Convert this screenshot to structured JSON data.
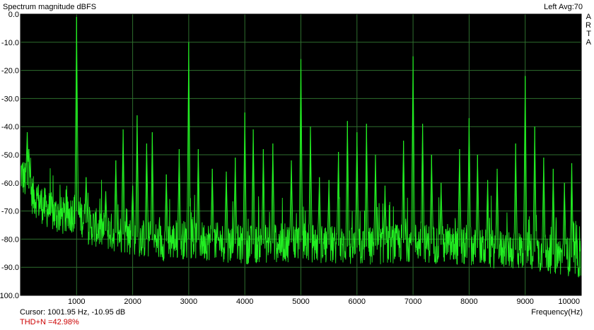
{
  "window": {
    "title": "Spectrum magnitude dBFS",
    "status": "Left  Avg:70",
    "brand": [
      "A",
      "R",
      "T",
      "A"
    ]
  },
  "footer": {
    "cursor": "Cursor: 1001.95 Hz, -10.95 dB",
    "thd": "THD+N =42.98%",
    "xlabel": "Frequency(Hz)"
  },
  "colors": {
    "plot_bg": "#000000",
    "grid": "#2e6e2e",
    "trace": "#22ee22",
    "thd_text": "#cc0000"
  },
  "chart_data": {
    "type": "line",
    "title": "Spectrum magnitude dBFS",
    "xlabel": "Frequency(Hz)",
    "ylabel": "",
    "xlim": [
      0,
      10000
    ],
    "ylim": [
      -100,
      0
    ],
    "x_ticks": [
      "1000",
      "2000",
      "3000",
      "4000",
      "5000",
      "6000",
      "7000",
      "8000",
      "9000",
      "10000"
    ],
    "y_ticks": [
      "0.0",
      "-10.0",
      "-20.0",
      "-30.0",
      "-40.0",
      "-50.0",
      "-60.0",
      "-70.0",
      "-80.0",
      "-90.0",
      "-100.0"
    ],
    "grid": true,
    "series": [
      {
        "values_noise_floor": [
          [
            100,
            -60
          ],
          [
            200,
            -64
          ],
          [
            400,
            -68
          ],
          [
            600,
            -71
          ],
          [
            800,
            -72
          ],
          [
            1000,
            -70
          ],
          [
            1200,
            -75
          ],
          [
            1500,
            -77
          ],
          [
            2000,
            -79
          ],
          [
            2500,
            -81
          ],
          [
            3000,
            -80
          ],
          [
            4000,
            -82
          ],
          [
            5000,
            -81
          ],
          [
            6000,
            -83
          ],
          [
            7000,
            -81
          ],
          [
            8000,
            -83
          ],
          [
            9000,
            -84
          ],
          [
            10000,
            -87
          ]
        ],
        "peaks": [
          [
            120,
            -42
          ],
          [
            150,
            -48
          ],
          [
            1000,
            -1
          ],
          [
            1170,
            -58
          ],
          [
            1520,
            -63
          ],
          [
            1700,
            -52
          ],
          [
            1830,
            -41
          ],
          [
            2000,
            -61
          ],
          [
            2080,
            -36
          ],
          [
            2250,
            -46
          ],
          [
            2350,
            -42
          ],
          [
            2600,
            -57
          ],
          [
            2830,
            -48
          ],
          [
            3000,
            -10
          ],
          [
            3170,
            -48
          ],
          [
            3420,
            -55
          ],
          [
            3670,
            -56
          ],
          [
            3830,
            -51
          ],
          [
            4000,
            -35
          ],
          [
            4150,
            -41
          ],
          [
            4330,
            -48
          ],
          [
            4500,
            -46
          ],
          [
            4830,
            -52
          ],
          [
            5000,
            -16
          ],
          [
            5170,
            -40
          ],
          [
            5330,
            -58
          ],
          [
            5500,
            -59
          ],
          [
            5670,
            -49
          ],
          [
            5830,
            -38
          ],
          [
            6000,
            -42
          ],
          [
            6170,
            -39
          ],
          [
            6330,
            -50
          ],
          [
            6500,
            -61
          ],
          [
            6830,
            -45
          ],
          [
            7000,
            -15
          ],
          [
            7170,
            -39
          ],
          [
            7330,
            -50
          ],
          [
            7500,
            -60
          ],
          [
            7830,
            -48
          ],
          [
            8000,
            -37
          ],
          [
            8150,
            -50
          ],
          [
            8330,
            -59
          ],
          [
            8500,
            -55
          ],
          [
            8830,
            -46
          ],
          [
            9000,
            -22
          ],
          [
            9170,
            -40
          ],
          [
            9330,
            -51
          ],
          [
            9500,
            -55
          ],
          [
            9700,
            -60
          ],
          [
            9830,
            -53
          ]
        ]
      }
    ]
  }
}
